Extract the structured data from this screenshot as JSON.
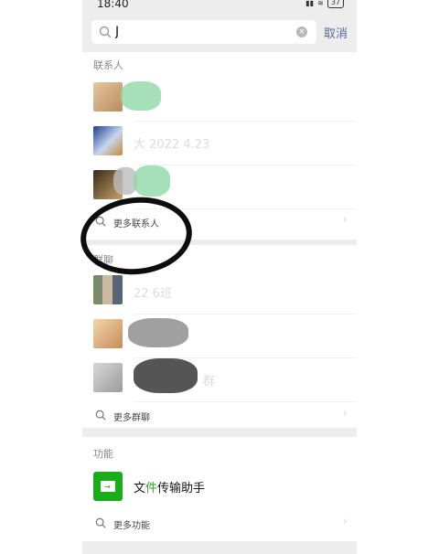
{
  "status_bar": {
    "time": "18:40",
    "battery": "37"
  },
  "search": {
    "query": "J",
    "cancel_label": "取消"
  },
  "contacts": {
    "title": "联系人",
    "items": [
      {
        "name": ""
      },
      {
        "name": "大 2022 4.23"
      },
      {
        "name": ""
      }
    ],
    "more_label": "更多联系人"
  },
  "groups": {
    "title": "群聊",
    "items": [
      {
        "name": "22 6班"
      },
      {
        "name": ""
      },
      {
        "name": "群"
      }
    ],
    "more_label": "更多群聊"
  },
  "functions": {
    "title": "功能",
    "item": {
      "name_pre": "文",
      "name_hl": "件",
      "name_post": "传输助手"
    },
    "more_label": "更多功能"
  },
  "colors": {
    "accent": "#1aad19",
    "link": "#576b95",
    "background": "#ededed"
  }
}
